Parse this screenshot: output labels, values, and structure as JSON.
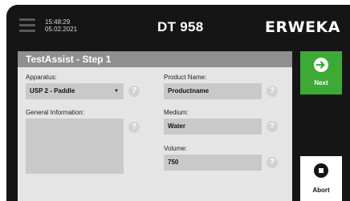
{
  "header": {
    "time": "15:48:29",
    "date": "05.02.2021",
    "device_title": "DT 958",
    "brand": "ERWEKA"
  },
  "dialog": {
    "title": "TestAssist - Step 1",
    "apparatus": {
      "label": "Apparatus:",
      "value": "USP 2 - Paddle"
    },
    "general_information": {
      "label": "General Information:",
      "value": ""
    },
    "product_name": {
      "label": "Product Name:",
      "value": "Productname"
    },
    "medium": {
      "label": "Medium:",
      "value": "Water"
    },
    "volume": {
      "label": "Volume:",
      "value": "750"
    },
    "help_glyph": "?"
  },
  "actions": {
    "next_label": "Next",
    "abort_label": "Abort"
  },
  "colors": {
    "background": "#151515",
    "panel": "#e5e5e5",
    "title_bar": "#8f8f8f",
    "field": "#c9c9c9",
    "next_button": "#3caa34",
    "abort_button": "#ffffff"
  },
  "icons": {
    "menu": "menu-icon",
    "next": "arrow-right-circle-icon",
    "abort": "stop-circle-icon",
    "help": "help-icon"
  }
}
